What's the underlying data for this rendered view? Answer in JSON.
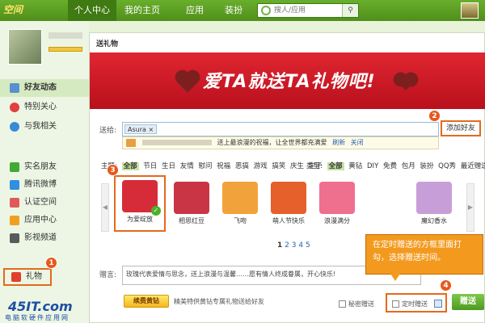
{
  "header": {
    "logo": "空间",
    "nav": [
      "个人中心",
      "我的主页",
      "应用",
      "装扮"
    ],
    "search_placeholder": "搜人/应用"
  },
  "sidebar": {
    "items": [
      {
        "label": "好友动态",
        "icon": "house-icon",
        "color": "#5a8fd0",
        "bold": true
      },
      {
        "label": "特别关心",
        "icon": "heart-icon",
        "color": "#e04040"
      },
      {
        "label": "与我相关",
        "icon": "at-icon",
        "color": "#3a8ad6"
      },
      {
        "label": "实名朋友",
        "icon": "clover-icon",
        "color": "#3faa35"
      },
      {
        "label": "腾讯微博",
        "icon": "weibo-icon",
        "color": "#2f8fe0"
      },
      {
        "label": "认证空间",
        "icon": "badge-icon",
        "color": "#e05a5a"
      },
      {
        "label": "应用中心",
        "icon": "apps-icon",
        "color": "#f0a020"
      },
      {
        "label": "影视频道",
        "icon": "film-icon",
        "color": "#5a5a5a"
      },
      {
        "label": "礼物",
        "icon": "gift-icon",
        "color": "#e0402a"
      }
    ]
  },
  "panel": {
    "title": "送礼物",
    "banner_text": "爱TA就送TA礼物吧!",
    "to_label": "送给:",
    "recipient": "Asura",
    "add_friend": "添加好友",
    "tip_text": "送上最浪漫的祝福，让全世界都充满爱",
    "tip_refresh": "刷新",
    "tip_close": "关闭",
    "theme_label": "主题:",
    "themes": [
      "全部",
      "节日",
      "生日",
      "友情",
      "慰问",
      "祝福",
      "恶搞",
      "游戏",
      "搞笑",
      "庆生",
      "生子"
    ],
    "type_label": "类型:",
    "types": [
      "全部",
      "黄钻",
      "DIY",
      "免费",
      "包月",
      "装扮",
      "QQ秀",
      "最近赠送"
    ],
    "gifts": [
      {
        "name": "为爱绽放",
        "color": "#d62c3a"
      },
      {
        "name": "相思红豆",
        "color": "#c93545"
      },
      {
        "name": "飞吻",
        "color": "#f2a23a"
      },
      {
        "name": "萌人节快乐",
        "color": "#e5602b"
      },
      {
        "name": "浪漫满分",
        "color": "#ef6f8e"
      },
      {
        "name": "魔幻香水",
        "color": "#c79ed8"
      }
    ],
    "pages": [
      "1",
      "2",
      "3",
      "4",
      "5"
    ],
    "msg_label": "赠言:",
    "msg_text": "玫瑰代表爱情与思念，送上浪漫与温馨……愿有情人终成眷属，开心快乐!",
    "vip_button": "续费黄钻",
    "vip_text": "精美特供黄钻专属礼物送给好友",
    "secret_label": "秘密赠送",
    "timer_label": "定时赠送",
    "send": "赠送"
  },
  "callout": {
    "text": "在定时赠送的方框里面打勾，选择赠送时间。"
  },
  "badges": [
    "1",
    "2",
    "3",
    "4"
  ],
  "watermark": {
    "main": "45IT.com",
    "sub": "电脑软硬件应用网"
  }
}
